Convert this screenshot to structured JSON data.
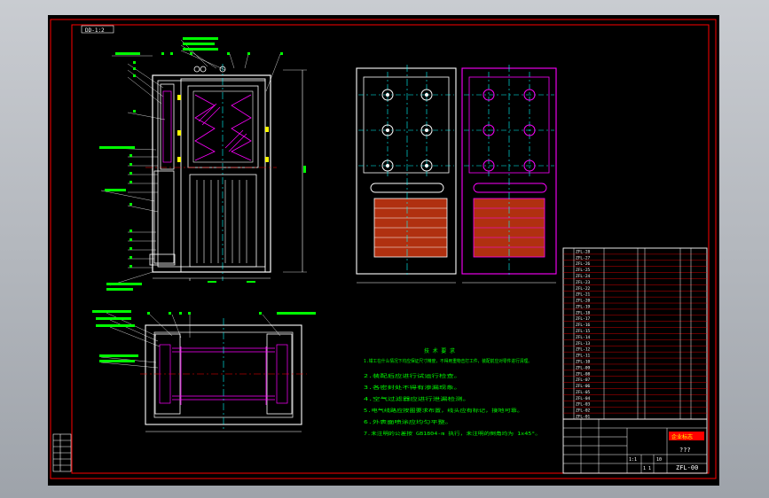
{
  "drawing": {
    "view_tag": "DD-1:2",
    "title_block": {
      "drawing_number": "ZFL-00",
      "drawing_name": "???",
      "company_label": "企业标志",
      "scale": "1:1",
      "sheet": "1 1",
      "seq": "10"
    },
    "notes": {
      "heading": "技 术 要 求",
      "lines": [
        "1.钳工在什么情况下均应保证尺寸精度，不得用重物击打工件，装配前应对零件进行清理。",
        "2.装配后应进行试运行检查。",
        "3.各密封处不得有渗漏现象。",
        "4.空气过滤器应进行泄漏检测。",
        "5.电气线路应按图要求布置，线头应有标记，接地可靠。",
        "6.外表面喷涂应均匀平整。",
        "7.未注明的公差按 GB1804-m 执行，未注明的倒角均为 1x45°。"
      ]
    },
    "parts_list_labels": [
      "ZFL-28",
      "ZFL-27",
      "ZFL-26",
      "ZFL-25",
      "ZFL-24",
      "ZFL-23",
      "ZFL-22",
      "ZFL-21",
      "ZFL-20",
      "ZFL-19",
      "ZFL-18",
      "ZFL-17",
      "ZFL-16",
      "ZFL-15",
      "ZFL-14",
      "ZFL-13",
      "ZFL-12",
      "ZFL-11",
      "ZFL-10",
      "ZFL-09",
      "ZFL-08",
      "ZFL-07",
      "ZFL-06",
      "ZFL-05",
      "ZFL-04",
      "ZFL-03",
      "ZFL-02",
      "ZFL-01"
    ]
  }
}
